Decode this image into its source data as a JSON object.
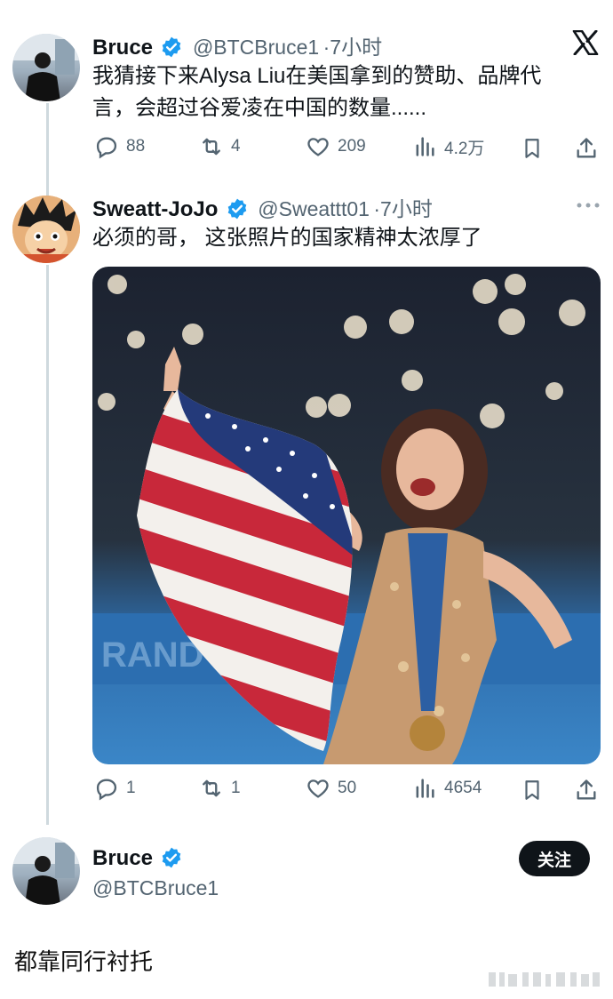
{
  "tweet1": {
    "name": "Bruce",
    "handle": "@BTCBruce1",
    "time": "·7小时",
    "text_line1": "我猜接下来Alysa Liu在美国拿到的赞助、品牌代",
    "text_line2": "言，会超过谷爱凌在中国的数量......",
    "replies": "88",
    "retweets": "4",
    "likes": "209",
    "views": "4.2万"
  },
  "tweet2": {
    "name": "Sweatt-JoJo",
    "handle": "@Sweattt01",
    "time": "·7小时",
    "text": "必须的哥， 这张照片的国家精神太浓厚了",
    "replies": "1",
    "retweets": "1",
    "likes": "50",
    "views": "4654"
  },
  "profile": {
    "name": "Bruce",
    "handle": "@BTCBruce1",
    "follow_label": "关注"
  },
  "caption": "都靠同行衬托",
  "icons": {
    "x_logo": "x-logo-icon",
    "verified": "verified-badge-icon",
    "more": "more-icon"
  },
  "colors": {
    "verified_blue": "#1d9bf0",
    "text_secondary": "#536471",
    "button_dark": "#0f1419"
  }
}
